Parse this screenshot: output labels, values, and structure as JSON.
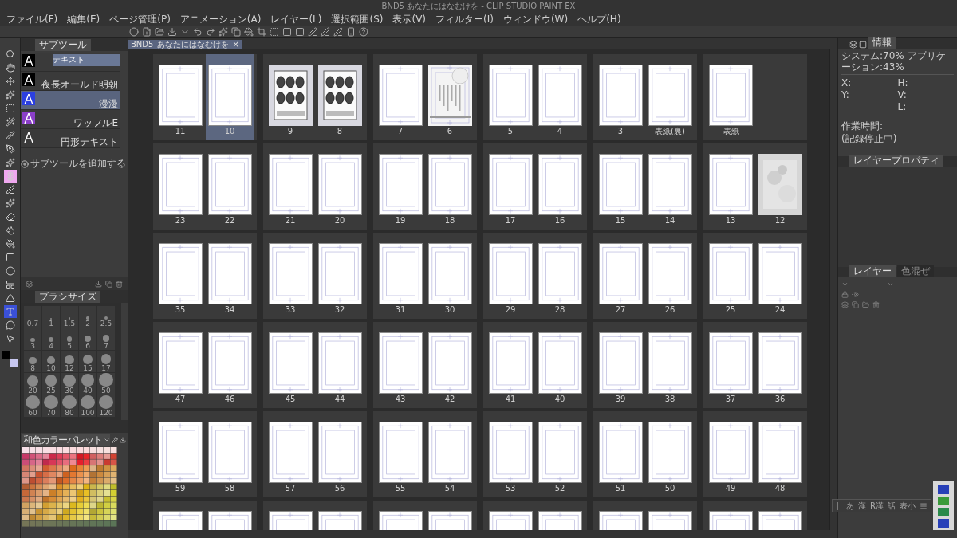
{
  "window": {
    "title": "BND5  あなたにはなむけを - CLIP STUDIO PAINT EX"
  },
  "menu": [
    "ファイル(F)",
    "編集(E)",
    "ページ管理(P)",
    "アニメーション(A)",
    "レイヤー(L)",
    "選択範囲(S)",
    "表示(V)",
    "フィルター(I)",
    "ウィンドウ(W)",
    "ヘルプ(H)"
  ],
  "document_tab": {
    "label": "BND5_あなたにはなむけを",
    "close": "×"
  },
  "tools": [
    {
      "selected": false,
      "marked": false
    },
    {
      "selected": false,
      "marked": false
    },
    {
      "selected": false,
      "marked": false
    },
    {
      "selected": false,
      "marked": false
    },
    {
      "selected": false,
      "marked": false
    },
    {
      "selected": false,
      "marked": false
    },
    {
      "selected": false,
      "marked": false
    },
    {
      "selected": false,
      "marked": false
    },
    {
      "selected": false,
      "marked": false
    },
    {
      "selected": false,
      "marked": true
    },
    {
      "selected": false,
      "marked": false
    },
    {
      "selected": false,
      "marked": false
    },
    {
      "selected": false,
      "marked": false
    },
    {
      "selected": false,
      "marked": false
    },
    {
      "selected": false,
      "marked": false
    },
    {
      "selected": false,
      "marked": false
    },
    {
      "selected": false,
      "marked": false
    },
    {
      "selected": false,
      "marked": false
    },
    {
      "selected": false,
      "marked": false
    },
    {
      "selected": true,
      "marked": false
    },
    {
      "selected": false,
      "marked": false
    },
    {
      "selected": false,
      "marked": false
    }
  ],
  "subtool_panel": {
    "tab": "サブツール",
    "items": [
      {
        "label": "テキスト",
        "selected": false,
        "editing": true,
        "color": "#000000"
      },
      {
        "label": "夜長オールド明朝",
        "selected": false,
        "editing": false,
        "color": "#000000"
      },
      {
        "label": "漫漫",
        "selected": true,
        "editing": false,
        "color": "#2b3fe0"
      },
      {
        "label": "ワッフルE",
        "selected": false,
        "editing": false,
        "color": "#8a3fc8"
      },
      {
        "label": "円形テキスト",
        "selected": false,
        "editing": false,
        "color": "#3a3a3a"
      }
    ],
    "add_button": "サブツールを追加する"
  },
  "brush_size": {
    "tab": "ブラシサイズ",
    "sizes": [
      "0.7",
      "1",
      "1.5",
      "2",
      "2.5",
      "3",
      "4",
      "5",
      "6",
      "7",
      "8",
      "10",
      "12",
      "15",
      "17",
      "20",
      "25",
      "30",
      "40",
      "50",
      "60",
      "70",
      "80",
      "100",
      "120"
    ]
  },
  "palette": {
    "name": "和色カラーパレット"
  },
  "info": {
    "tab": "情報",
    "memory": "システム:70% アプリケーション:43%",
    "x": "X:",
    "y": "Y:",
    "h": "H:",
    "v": "V:",
    "l": "L:",
    "work_time": "作業時間:",
    "status": "(記録停止中)"
  },
  "layer_property": {
    "tab": "レイヤープロパティ"
  },
  "layer": {
    "tabs": [
      {
        "label": "レイヤー",
        "selected": true
      },
      {
        "label": "色混ぜ",
        "selected": false
      }
    ]
  },
  "text_toolbar": {
    "items": [
      "あ",
      "漢",
      "R漢",
      "話",
      "表小"
    ]
  },
  "rows": [
    [
      {
        "pages": [
          {
            "label": "11",
            "kind": "blank",
            "selected": false
          },
          {
            "label": "10",
            "kind": "blank",
            "selected": true
          }
        ]
      },
      {
        "pages": [
          {
            "label": "9",
            "kind": "art",
            "selected": false
          },
          {
            "label": "8",
            "kind": "art",
            "selected": false
          }
        ]
      },
      {
        "pages": [
          {
            "label": "7",
            "kind": "blank",
            "selected": false
          },
          {
            "label": "6",
            "kind": "text",
            "selected": false
          }
        ]
      },
      {
        "pages": [
          {
            "label": "5",
            "kind": "blank",
            "selected": false
          },
          {
            "label": "4",
            "kind": "blank",
            "selected": false
          }
        ]
      },
      {
        "pages": [
          {
            "label": "3",
            "kind": "blank",
            "selected": false
          },
          {
            "label": "表紙(裏)",
            "kind": "blank",
            "selected": false
          }
        ]
      },
      {
        "pages": [
          {
            "label": "表紙",
            "kind": "blank",
            "selected": false
          }
        ]
      }
    ],
    [
      {
        "pages": [
          {
            "label": "23",
            "kind": "blank",
            "selected": false
          },
          {
            "label": "22",
            "kind": "blank",
            "selected": false
          }
        ]
      },
      {
        "pages": [
          {
            "label": "21",
            "kind": "blank",
            "selected": false
          },
          {
            "label": "20",
            "kind": "blank",
            "selected": false
          }
        ]
      },
      {
        "pages": [
          {
            "label": "19",
            "kind": "blank",
            "selected": false
          },
          {
            "label": "18",
            "kind": "blank",
            "selected": false
          }
        ]
      },
      {
        "pages": [
          {
            "label": "17",
            "kind": "blank",
            "selected": false
          },
          {
            "label": "16",
            "kind": "blank",
            "selected": false
          }
        ]
      },
      {
        "pages": [
          {
            "label": "15",
            "kind": "blank",
            "selected": false
          },
          {
            "label": "14",
            "kind": "blank",
            "selected": false
          }
        ]
      },
      {
        "pages": [
          {
            "label": "13",
            "kind": "blank",
            "selected": false
          },
          {
            "label": "12",
            "kind": "texture",
            "selected": false
          }
        ]
      }
    ],
    [
      {
        "pages": [
          {
            "label": "35",
            "kind": "blank",
            "selected": false
          },
          {
            "label": "34",
            "kind": "blank",
            "selected": false
          }
        ]
      },
      {
        "pages": [
          {
            "label": "33",
            "kind": "blank",
            "selected": false
          },
          {
            "label": "32",
            "kind": "blank",
            "selected": false
          }
        ]
      },
      {
        "pages": [
          {
            "label": "31",
            "kind": "blank",
            "selected": false
          },
          {
            "label": "30",
            "kind": "blank",
            "selected": false
          }
        ]
      },
      {
        "pages": [
          {
            "label": "29",
            "kind": "blank",
            "selected": false
          },
          {
            "label": "28",
            "kind": "blank",
            "selected": false
          }
        ]
      },
      {
        "pages": [
          {
            "label": "27",
            "kind": "blank",
            "selected": false
          },
          {
            "label": "26",
            "kind": "blank",
            "selected": false
          }
        ]
      },
      {
        "pages": [
          {
            "label": "25",
            "kind": "blank",
            "selected": false
          },
          {
            "label": "24",
            "kind": "blank",
            "selected": false
          }
        ]
      }
    ],
    [
      {
        "pages": [
          {
            "label": "47",
            "kind": "blank",
            "selected": false
          },
          {
            "label": "46",
            "kind": "blank",
            "selected": false
          }
        ]
      },
      {
        "pages": [
          {
            "label": "45",
            "kind": "blank",
            "selected": false
          },
          {
            "label": "44",
            "kind": "blank",
            "selected": false
          }
        ]
      },
      {
        "pages": [
          {
            "label": "43",
            "kind": "blank",
            "selected": false
          },
          {
            "label": "42",
            "kind": "blank",
            "selected": false
          }
        ]
      },
      {
        "pages": [
          {
            "label": "41",
            "kind": "blank",
            "selected": false
          },
          {
            "label": "40",
            "kind": "blank",
            "selected": false
          }
        ]
      },
      {
        "pages": [
          {
            "label": "39",
            "kind": "blank",
            "selected": false
          },
          {
            "label": "38",
            "kind": "blank",
            "selected": false
          }
        ]
      },
      {
        "pages": [
          {
            "label": "37",
            "kind": "blank",
            "selected": false
          },
          {
            "label": "36",
            "kind": "blank",
            "selected": false
          }
        ]
      }
    ],
    [
      {
        "pages": [
          {
            "label": "59",
            "kind": "blank",
            "selected": false
          },
          {
            "label": "58",
            "kind": "blank",
            "selected": false
          }
        ]
      },
      {
        "pages": [
          {
            "label": "57",
            "kind": "blank",
            "selected": false
          },
          {
            "label": "56",
            "kind": "blank",
            "selected": false
          }
        ]
      },
      {
        "pages": [
          {
            "label": "55",
            "kind": "blank",
            "selected": false
          },
          {
            "label": "54",
            "kind": "blank",
            "selected": false
          }
        ]
      },
      {
        "pages": [
          {
            "label": "53",
            "kind": "blank",
            "selected": false
          },
          {
            "label": "52",
            "kind": "blank",
            "selected": false
          }
        ]
      },
      {
        "pages": [
          {
            "label": "51",
            "kind": "blank",
            "selected": false
          },
          {
            "label": "50",
            "kind": "blank",
            "selected": false
          }
        ]
      },
      {
        "pages": [
          {
            "label": "49",
            "kind": "blank",
            "selected": false
          },
          {
            "label": "48",
            "kind": "blank",
            "selected": false
          }
        ]
      }
    ],
    [
      {
        "pages": [
          {
            "kind": "blank",
            "selected": false
          },
          {
            "kind": "blank",
            "selected": false
          }
        ]
      },
      {
        "pages": [
          {
            "kind": "blank",
            "selected": false
          },
          {
            "kind": "blank",
            "selected": false
          }
        ]
      },
      {
        "pages": [
          {
            "kind": "blank",
            "selected": false
          },
          {
            "kind": "blank",
            "selected": false
          }
        ]
      },
      {
        "pages": [
          {
            "kind": "blank",
            "selected": false
          },
          {
            "kind": "blank",
            "selected": false
          }
        ]
      },
      {
        "pages": [
          {
            "kind": "blank",
            "selected": false
          },
          {
            "kind": "blank",
            "selected": false
          }
        ]
      },
      {
        "pages": [
          {
            "kind": "blank",
            "selected": false
          },
          {
            "kind": "blank",
            "selected": false
          }
        ]
      }
    ]
  ]
}
